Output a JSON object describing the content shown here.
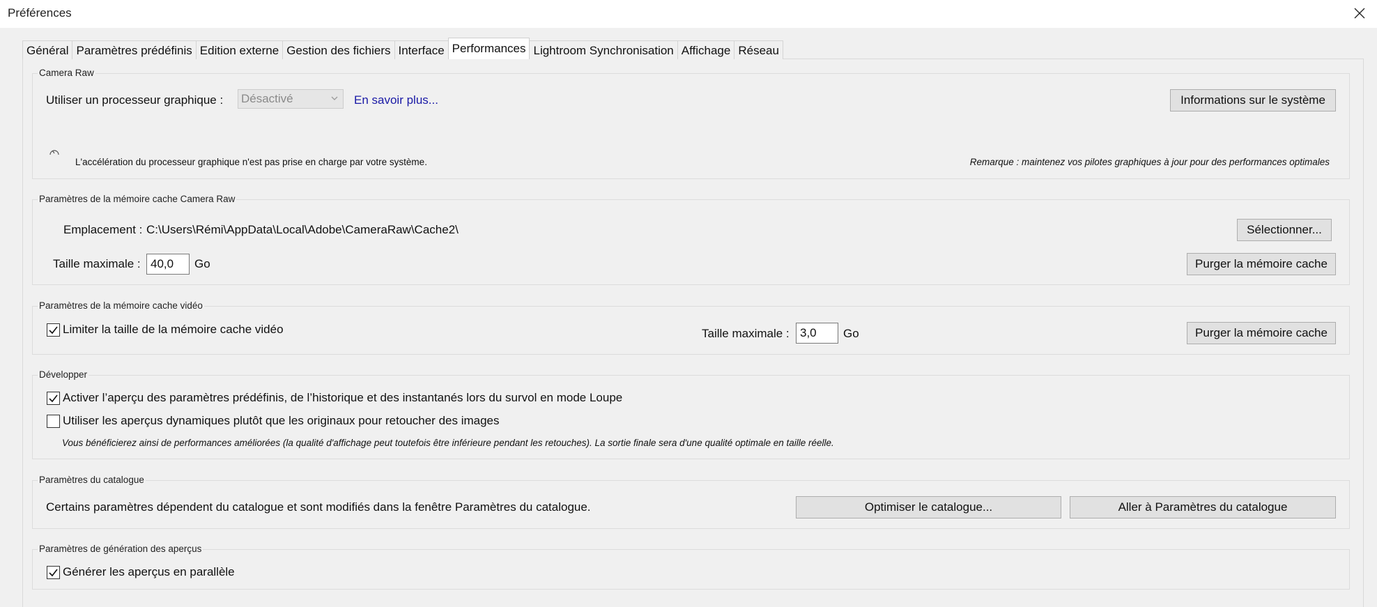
{
  "window": {
    "title": "Préférences"
  },
  "tabs": [
    {
      "label": "Général"
    },
    {
      "label": "Paramètres prédéfinis"
    },
    {
      "label": "Edition externe"
    },
    {
      "label": "Gestion des fichiers"
    },
    {
      "label": "Interface"
    },
    {
      "label": "Performances",
      "active": true
    },
    {
      "label": "Lightroom Synchronisation"
    },
    {
      "label": "Affichage"
    },
    {
      "label": "Réseau"
    }
  ],
  "camera_raw": {
    "group_label": "Camera Raw",
    "gpu_label": "Utiliser un processeur graphique :",
    "gpu_value": "Désactivé",
    "learn_more": "En savoir plus...",
    "system_info_button": "Informations sur le système",
    "gpu_message": "L'accélération du processeur graphique n'est pas prise en charge par votre système.",
    "drivers_note": "Remarque : maintenez vos pilotes graphiques à jour pour des performances optimales"
  },
  "raw_cache": {
    "group_label": "Paramètres de la mémoire cache Camera Raw",
    "location_label": "Emplacement :",
    "location_value": "C:\\Users\\Rémi\\AppData\\Local\\Adobe\\CameraRaw\\Cache2\\",
    "select_button": "Sélectionner...",
    "max_size_label": "Taille maximale :",
    "max_size_value": "40,0",
    "unit": "Go",
    "purge_button": "Purger la mémoire cache"
  },
  "video_cache": {
    "group_label": "Paramètres de la mémoire cache vidéo",
    "limit_label": "Limiter la taille de la mémoire cache vidéo",
    "limit_checked": true,
    "max_size_label": "Taille maximale :",
    "max_size_value": "3,0",
    "unit": "Go",
    "purge_button": "Purger la mémoire cache"
  },
  "develop": {
    "group_label": "Développer",
    "preview_label": "Activer l’aperçu des paramètres prédéfinis, de l’historique et des instantanés lors du survol en mode Loupe",
    "preview_checked": true,
    "smart_previews_label": "Utiliser les aperçus dynamiques plutôt que les originaux pour retoucher des images",
    "smart_previews_checked": false,
    "smart_previews_note": "Vous bénéficierez ainsi de performances améliorées (la qualité d'affichage peut toutefois être inférieure pendant les retouches). La sortie finale sera d'une qualité optimale en taille réelle."
  },
  "catalog": {
    "group_label": "Paramètres du catalogue",
    "description": "Certains paramètres dépendent du catalogue et sont modifiés dans la fenêtre Paramètres du catalogue.",
    "optimize_button": "Optimiser le catalogue...",
    "goto_button": "Aller à Paramètres du catalogue"
  },
  "preview_generation": {
    "group_label": "Paramètres de génération des aperçus",
    "parallel_label": "Générer les aperçus en parallèle",
    "parallel_checked": true
  }
}
